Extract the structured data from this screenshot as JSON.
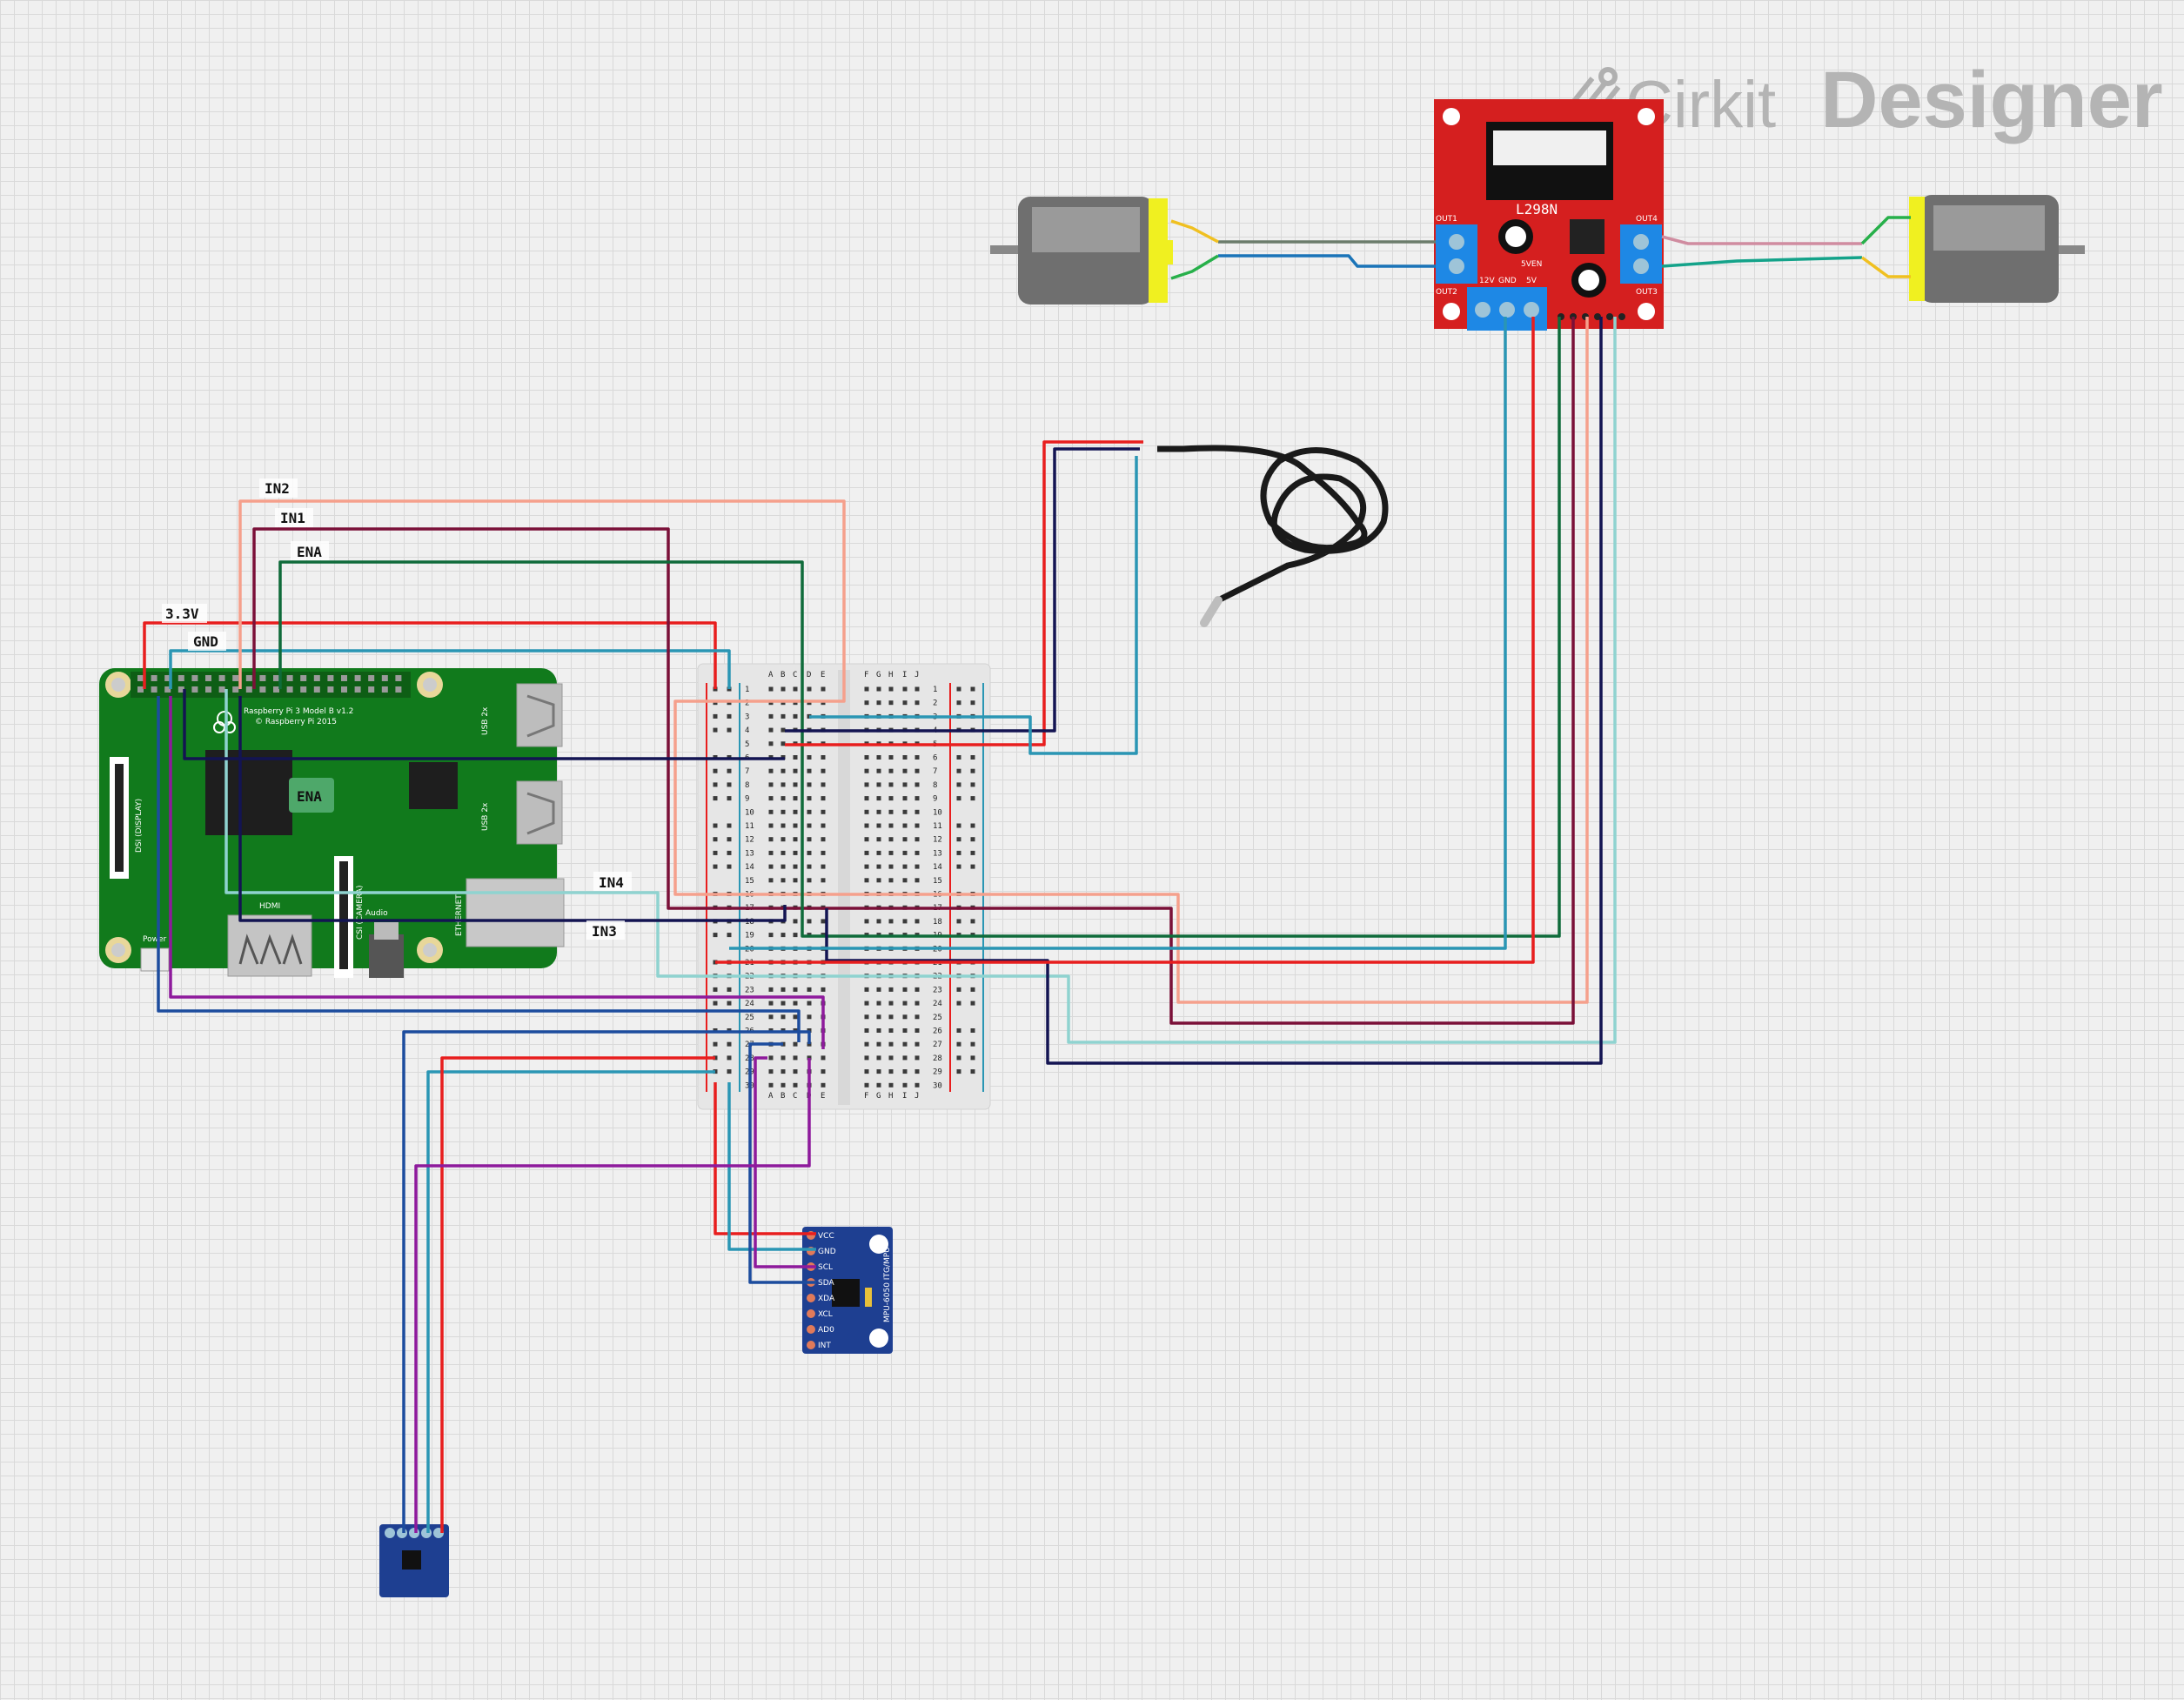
{
  "brand": {
    "part1": "Cirkit",
    "part2": "Designer"
  },
  "net_labels": {
    "in2": "IN2",
    "in1": "IN1",
    "ena": "ENA",
    "v33": "3.3V",
    "gnd": "GND",
    "in4": "IN4",
    "in3": "IN3",
    "ena_pad": "ENA"
  },
  "raspberry_pi": {
    "title": "Raspberry Pi 3 Model B v1.2",
    "copyright": "© Raspberry Pi 2015",
    "usb1": "USB 2x",
    "usb2": "USB 2x",
    "ethernet": "ETHERNET",
    "hdmi": "HDMI",
    "power": "Power",
    "dsi": "DSI (DISPLAY)",
    "csi": "CSI (CAMERA)",
    "audio": "Audio"
  },
  "driver": {
    "chip": "L298N",
    "out1": "OUT1",
    "out2": "OUT2",
    "out3": "OUT3",
    "out4": "OUT4",
    "power_labels": [
      "12V",
      "GND",
      "5V"
    ],
    "enable_label": "5VEN"
  },
  "imu": {
    "name": "MPU-6050 ITG/MPU",
    "pins": [
      "VCC",
      "GND",
      "SCL",
      "SDA",
      "XDA",
      "XCL",
      "AD0",
      "INT"
    ]
  },
  "breadboard": {
    "left_columns": [
      "A",
      "B",
      "C",
      "D",
      "E"
    ],
    "right_columns": [
      "F",
      "G",
      "H",
      "I",
      "J"
    ],
    "rows": [
      "1",
      "2",
      "3",
      "4",
      "5",
      "6",
      "7",
      "8",
      "9",
      "10",
      "11",
      "12",
      "13",
      "14",
      "15",
      "16",
      "17",
      "18",
      "19",
      "20",
      "21",
      "22",
      "23",
      "24",
      "25",
      "26",
      "27",
      "28",
      "29",
      "30"
    ]
  },
  "colors": {
    "red": "#e81e1e",
    "teal": "#2a96b4",
    "navy": "#131452",
    "salmon": "#f5a08c",
    "maroon": "#7a1038",
    "green": "#0f6b3a",
    "purple": "#8e1a9c",
    "blue": "#1c4c9e",
    "lightteal": "#8fd3d0",
    "grey": "#6b7c6b",
    "pink": "#d08ca0",
    "board_green": "#117a1c",
    "driver_red": "#d51f1f",
    "imu_blue": "#1e3f91"
  }
}
